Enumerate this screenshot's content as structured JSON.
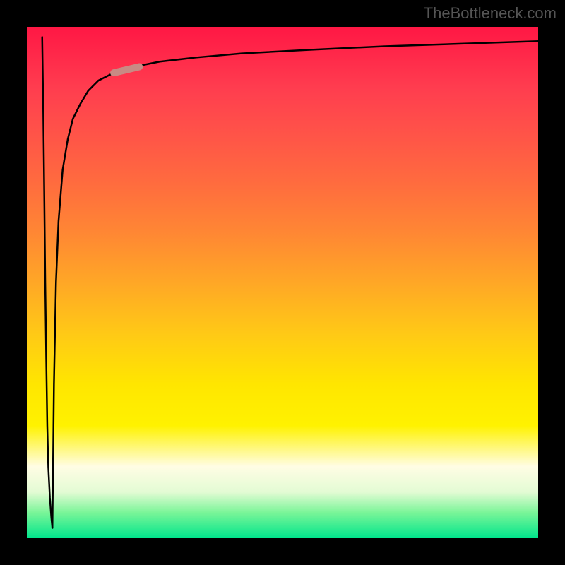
{
  "watermark": "TheBottleneck.com",
  "chart_data": {
    "type": "line",
    "title": "",
    "xlabel": "",
    "ylabel": "",
    "xlim": [
      0,
      100
    ],
    "ylim": [
      0,
      100
    ],
    "background_gradient_stops": [
      {
        "pos": 0,
        "color": "#ff1744"
      },
      {
        "pos": 20,
        "color": "#ff5149"
      },
      {
        "pos": 40,
        "color": "#ff8634"
      },
      {
        "pos": 60,
        "color": "#ffc916"
      },
      {
        "pos": 80,
        "color": "#fff200"
      },
      {
        "pos": 95,
        "color": "#7af598"
      },
      {
        "pos": 100,
        "color": "#00e58c"
      }
    ],
    "series": [
      {
        "name": "curve-down",
        "stroke": "#000000",
        "x": [
          3.0,
          3.2,
          3.4,
          3.6,
          3.8,
          4.0,
          4.2,
          4.5,
          4.8,
          5.0
        ],
        "y": [
          98,
          85,
          68,
          50,
          35,
          22,
          14,
          8,
          4,
          2
        ]
      },
      {
        "name": "curve-up",
        "stroke": "#000000",
        "x": [
          5.0,
          5.3,
          5.7,
          6.2,
          7.0,
          8.0,
          9.0,
          10.5,
          12.0,
          14.0,
          17.0,
          21.0,
          26.0,
          33.0,
          42.0,
          55.0,
          70.0,
          85.0,
          100.0
        ],
        "y": [
          2,
          30,
          50,
          62,
          72,
          78,
          82,
          85,
          87.5,
          89.5,
          91,
          92.2,
          93.2,
          94,
          94.8,
          95.5,
          96.2,
          96.7,
          97.2
        ]
      }
    ],
    "marker": {
      "color": "#c88a84",
      "x_range": [
        17,
        22
      ],
      "y_range": [
        91,
        92.2
      ],
      "width": 10,
      "cap": "round"
    }
  }
}
